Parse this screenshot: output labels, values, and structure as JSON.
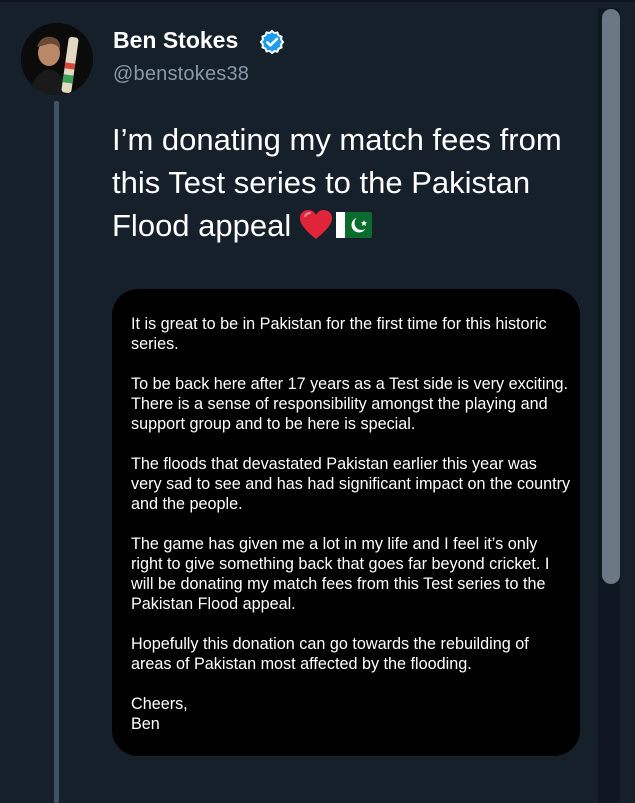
{
  "author": {
    "name": "Ben Stokes",
    "handle": "@benstokes38",
    "verified_icon": "verified-badge-icon",
    "avatar_icon": "profile-photo"
  },
  "tweet": {
    "text": "I’m donating my match fees from this Test series to the Pakistan Flood appeal",
    "emojis": [
      "red-heart-icon",
      "pakistan-flag-icon"
    ]
  },
  "statement": {
    "paragraphs": [
      "It is great to be in Pakistan for the first time for this historic series.",
      "To be back here after 17 years as a Test side is very exciting. There is a sense of responsibility amongst the playing and support group and to be here is special.",
      "The floods that devastated Pakistan earlier this year was very sad to see and has had significant impact on the country and the people.",
      "The game has given me a lot in my life and I feel it’s only right to give something back that goes far beyond cricket. I will be donating my match fees from this Test series to the Pakistan Flood appeal.",
      "Hopefully this donation can go towards the rebuilding of areas of Pakistan most affected by the flooding."
    ],
    "signoff": "Cheers,",
    "signature": "Ben"
  },
  "colors": {
    "background": "#15202b",
    "card": "#000000",
    "handle": "#8b98a5",
    "verified": "#1d9bf0",
    "thread_line": "#3d5466"
  }
}
